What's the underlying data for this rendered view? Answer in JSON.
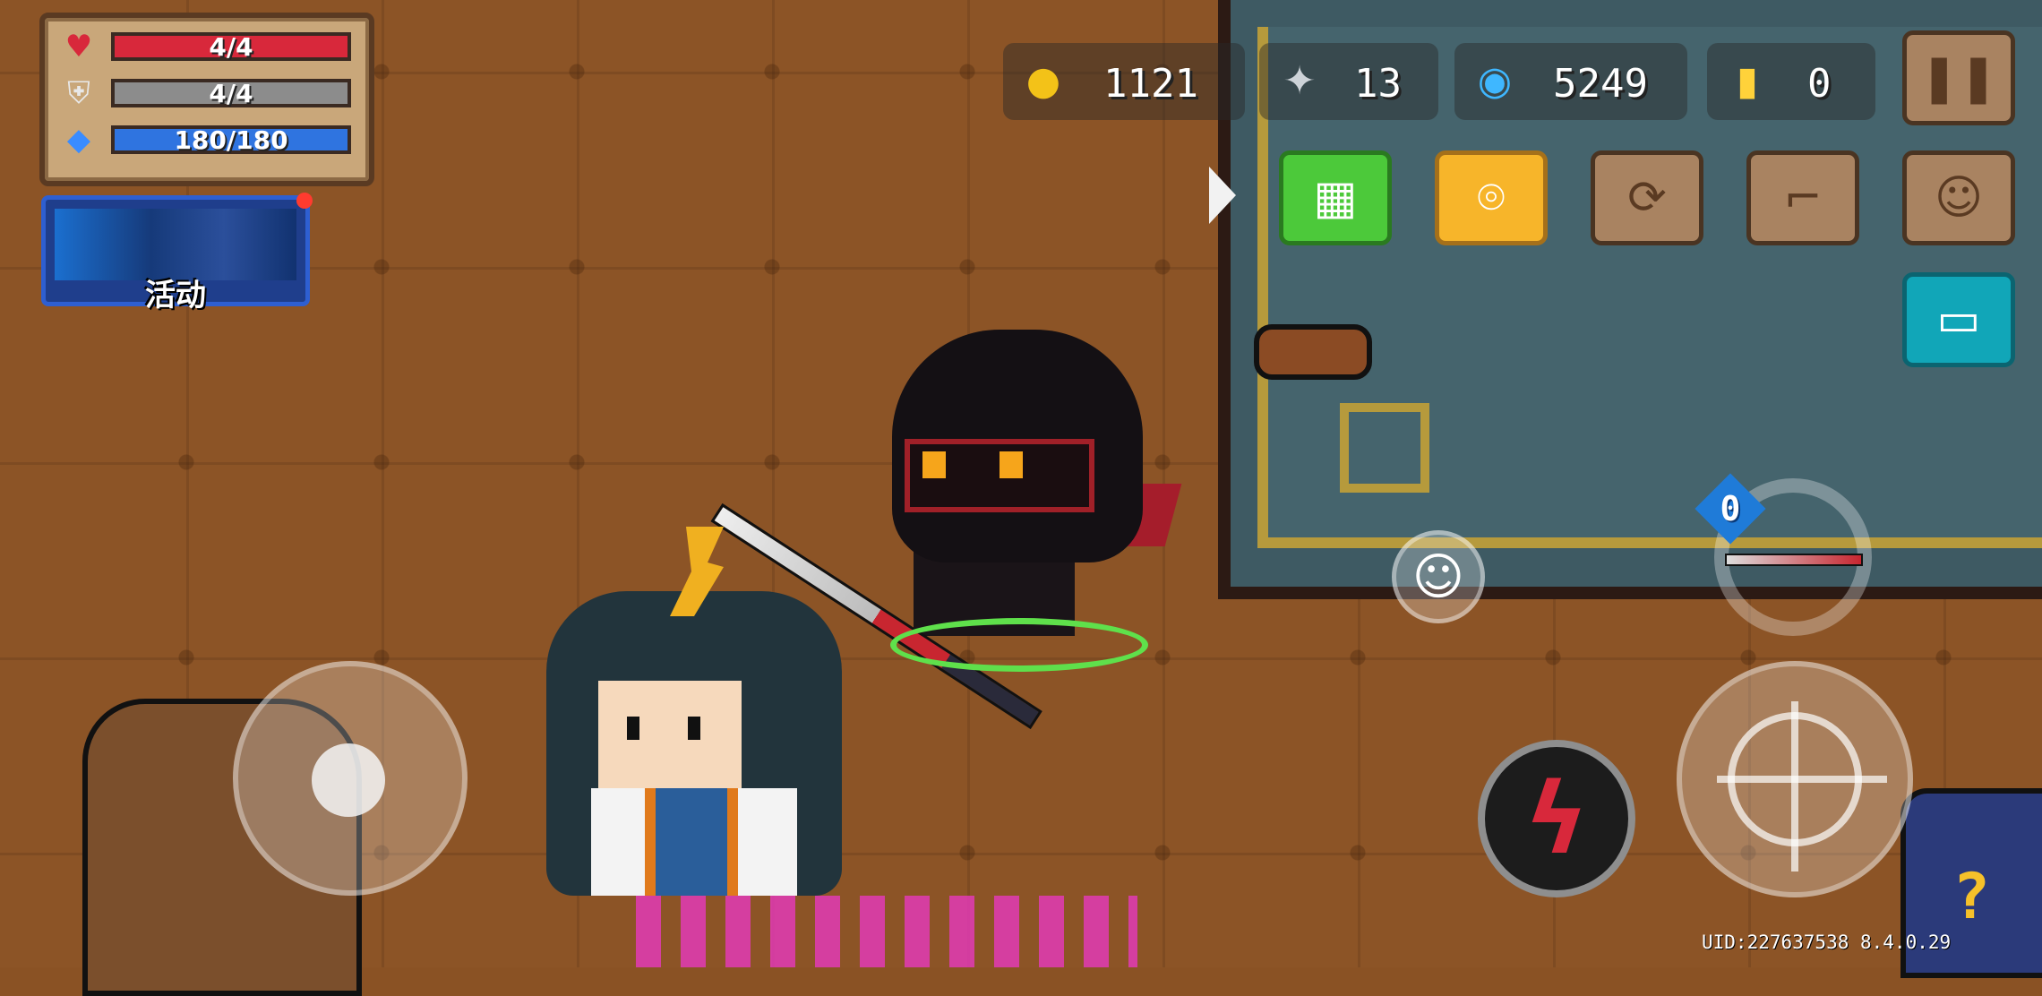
{
  "hud": {
    "hp": "4/4",
    "armor": "4/4",
    "energy": "180/180",
    "hp_icon": "heart-icon",
    "armor_icon": "shield-icon",
    "energy_icon": "energy-crystal-icon"
  },
  "event": {
    "label": "活动",
    "has_notification": true
  },
  "currency": {
    "coins": "1121",
    "fish": "13",
    "gems": "5249",
    "gold": "0"
  },
  "top_buttons": [
    {
      "icon": "qr-chat-icon"
    },
    {
      "icon": "location-pin-icon"
    },
    {
      "icon": "friends-sync-icon"
    },
    {
      "icon": "stairs-icon"
    },
    {
      "icon": "profile-card-icon"
    }
  ],
  "weapon": {
    "swap_count": "0"
  },
  "footer": {
    "uid": "UID:227637538 8.4.0.29"
  },
  "colors": {
    "hp": "#d8283b",
    "armor": "#8c8c8c",
    "energy": "#2f74e0",
    "floor": "#8c5426"
  }
}
